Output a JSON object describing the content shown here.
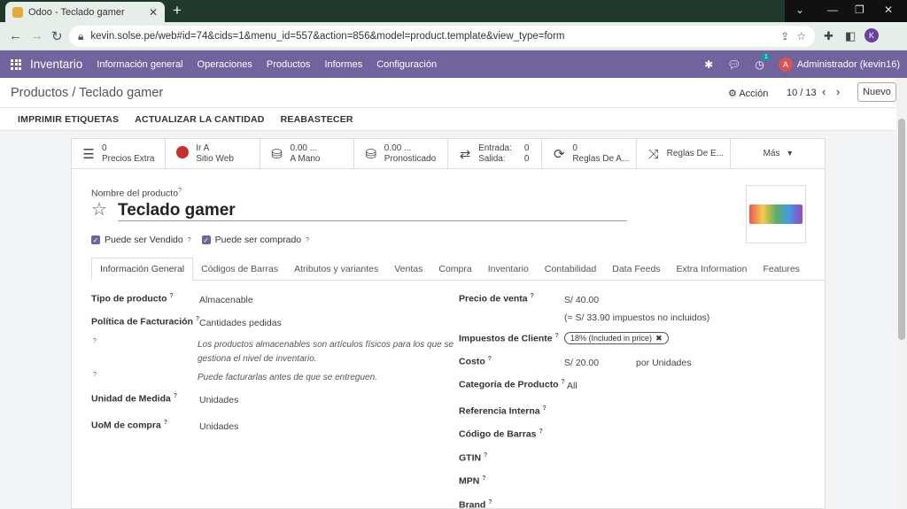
{
  "browser": {
    "tab_title": "Odoo - Teclado gamer",
    "url": "kevin.solse.pe/web#id=74&cids=1&menu_id=557&action=856&model=product.template&view_type=form",
    "profile_initial": "K"
  },
  "navbar": {
    "app_name": "Inventario",
    "menu": [
      "Información general",
      "Operaciones",
      "Productos",
      "Informes",
      "Configuración"
    ],
    "activity_count": "1",
    "user_initial": "A",
    "user_name": "Administrador (kevin16)"
  },
  "control": {
    "breadcrumb": "Productos / Teclado gamer",
    "action_label": "Acción",
    "pager": "10 / 13",
    "new_label": "Nuevo"
  },
  "statusbar": {
    "buttons": [
      "IMPRIMIR ETIQUETAS",
      "ACTUALIZAR LA CANTIDAD",
      "REABASTECER"
    ]
  },
  "smart_buttons": {
    "prices": {
      "value": "0",
      "label": "Precios Extra"
    },
    "website": {
      "value": "Ir A",
      "label": "Sitio Web"
    },
    "on_hand": {
      "value": "0.00 ...",
      "label": "A Mano"
    },
    "forecast": {
      "value": "0.00 ...",
      "label": "Pronosticado"
    },
    "moves": {
      "in_label": "Entrada:",
      "in_value": "0",
      "out_label": "Salida:",
      "out_value": "0"
    },
    "rules": {
      "value": "0",
      "label": "Reglas De A..."
    },
    "routes": {
      "label": "Reglas De E..."
    },
    "more": {
      "label": "Más"
    }
  },
  "product": {
    "name_label": "Nombre del producto",
    "name": "Teclado gamer",
    "can_be_sold": "Puede ser Vendido",
    "can_be_purchased": "Puede ser comprado"
  },
  "tabs": [
    "Información General",
    "Códigos de Barras",
    "Atributos y variantes",
    "Ventas",
    "Compra",
    "Inventario",
    "Contabilidad",
    "Data Feeds",
    "Extra Information",
    "Features"
  ],
  "fields_left": {
    "type_label": "Tipo de producto",
    "type_value": "Almacenable",
    "invoice_label": "Política de Facturación",
    "invoice_value": "Cantidades pedidas",
    "help1": "Los productos almacenables son artículos físicos para los que se gestiona el nivel de inventario.",
    "help2": "Puede facturarlas antes de que se entreguen.",
    "uom_label": "Unidad de Medida",
    "uom_value": "Unidades",
    "uom_po_label": "UoM de compra",
    "uom_po_value": "Unidades"
  },
  "fields_right": {
    "price_label": "Precio de venta",
    "price_value": "S/ 40.00",
    "price_note": "(= S/ 33.90 impuestos no incluidos)",
    "tax_label": "Impuestos de Cliente",
    "tax_value": "18% (Included in price)",
    "cost_label": "Costo",
    "cost_value": "S/ 20.00",
    "cost_unit": "por Unidades",
    "category_label": "Categoría de Producto",
    "category_value": "All",
    "ref_label": "Referencia Interna",
    "barcode_label": "Código de Barras",
    "gtin_label": "GTIN",
    "mpn_label": "MPN",
    "brand_label": "Brand"
  }
}
